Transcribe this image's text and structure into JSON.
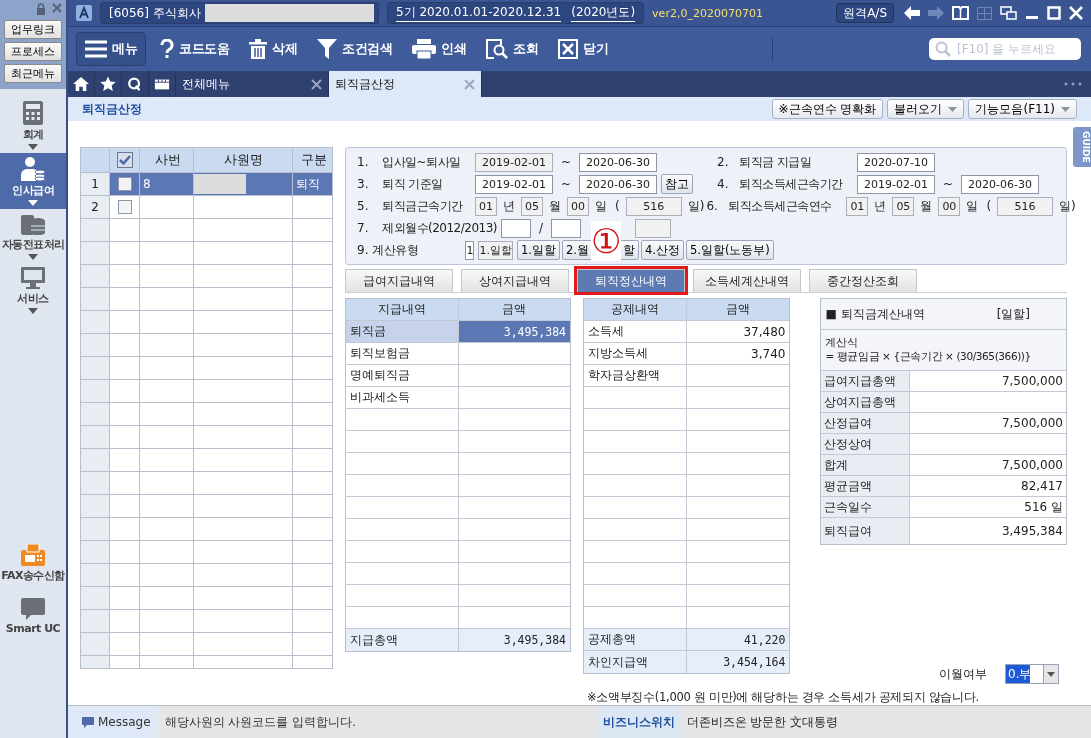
{
  "title_bar": {
    "company": "[6056] 주식회사",
    "period": "5기  2020.01.01-2020.12.31",
    "year": "(2020년도)",
    "version": "ver2,0_2020070701",
    "remote_button": "원격A/S"
  },
  "left_buttons": [
    "업무링크",
    "프로세스",
    "최근메뉴"
  ],
  "modules": [
    {
      "label": "회계",
      "kind": "calculator",
      "selected": false
    },
    {
      "label": "인사급여",
      "kind": "person",
      "selected": true
    },
    {
      "label": "자동전표처리",
      "kind": "database",
      "selected": false
    },
    {
      "label": "서비스",
      "kind": "monitor",
      "selected": false
    }
  ],
  "extra_modules": [
    {
      "label": "FAX송수신함",
      "kind": "fax"
    },
    {
      "label": "Smart UC",
      "kind": "uc"
    }
  ],
  "toolbar": [
    {
      "label": "메뉴",
      "kind": "menu"
    },
    {
      "label": "코드도움",
      "kind": "help"
    },
    {
      "label": "삭제",
      "kind": "trash"
    },
    {
      "label": "조건검색",
      "kind": "filter"
    },
    {
      "label": "인쇄",
      "kind": "print"
    },
    {
      "label": "조회",
      "kind": "view"
    },
    {
      "label": "닫기",
      "kind": "close"
    }
  ],
  "search": {
    "placeholder": "[F10] 을 누르세요"
  },
  "tabs": [
    {
      "label": "전체메뉴",
      "selected": false
    },
    {
      "label": "퇴직금산정",
      "selected": true
    }
  ],
  "page_title": "퇴직금산정",
  "page_buttons": [
    {
      "label": "※근속연수 명확화",
      "dropdown": false
    },
    {
      "label": "불러오기",
      "dropdown": true
    },
    {
      "label": "기능모음(F11)",
      "dropdown": true
    }
  ],
  "guide_tab": "GUIDE",
  "employees": {
    "columns": [
      "사번",
      "사원명",
      "구분"
    ],
    "header_checked": true,
    "rows": [
      {
        "no": "1",
        "checked": false,
        "id": "8",
        "type": "퇴직",
        "name_hidden": true,
        "selected": true
      },
      {
        "no": "2",
        "checked": false,
        "name_hidden": false,
        "selected": false
      }
    ]
  },
  "form": [
    {
      "left": [
        {
          "kind": "num",
          "text": "1."
        },
        {
          "kind": "label",
          "text": "입사일~퇴사일"
        },
        {
          "kind": "date_ro",
          "text": "2019-02-01"
        },
        {
          "kind": "sep",
          "text": "~"
        },
        {
          "kind": "date",
          "text": "2020-06-30"
        }
      ],
      "right": [
        {
          "kind": "num",
          "text": "2."
        },
        {
          "kind": "label",
          "text": "퇴직금 지급일"
        },
        {
          "kind": "date",
          "text": "2020-07-10"
        }
      ]
    },
    {
      "left": [
        {
          "kind": "num",
          "text": "3."
        },
        {
          "kind": "label",
          "text": "퇴직 기준일"
        },
        {
          "kind": "date",
          "text": "2019-02-01"
        },
        {
          "kind": "sep",
          "text": "~"
        },
        {
          "kind": "date",
          "text": "2020-06-30"
        },
        {
          "kind": "button",
          "text": "참고"
        }
      ],
      "right": [
        {
          "kind": "num",
          "text": "4."
        },
        {
          "kind": "label",
          "text": "퇴직소득세근속기간"
        },
        {
          "kind": "date",
          "text": "2019-02-01"
        },
        {
          "kind": "sep",
          "text": "~"
        },
        {
          "kind": "date",
          "text": "2020-06-30"
        }
      ]
    },
    {
      "left": [
        {
          "kind": "num",
          "text": "5."
        },
        {
          "kind": "label",
          "text": "퇴직금근속기간"
        },
        {
          "kind": "small_ro",
          "text": "01"
        },
        {
          "kind": "unit",
          "text": "년"
        },
        {
          "kind": "small_ro",
          "text": "05"
        },
        {
          "kind": "unit",
          "text": "월"
        },
        {
          "kind": "small_ro",
          "text": "00"
        },
        {
          "kind": "unit",
          "text": "일"
        },
        {
          "kind": "unit",
          "text": "("
        },
        {
          "kind": "days_ro",
          "text": "516"
        },
        {
          "kind": "unit",
          "text": "일)"
        }
      ],
      "right": [
        {
          "kind": "num",
          "text": "6."
        },
        {
          "kind": "label",
          "text": "퇴직소득세근속연수"
        },
        {
          "kind": "small_ro",
          "text": "01"
        },
        {
          "kind": "unit",
          "text": "년"
        },
        {
          "kind": "small_ro",
          "text": "05"
        },
        {
          "kind": "unit",
          "text": "월"
        },
        {
          "kind": "small_ro",
          "text": "00"
        },
        {
          "kind": "unit",
          "text": "일"
        },
        {
          "kind": "unit",
          "text": "("
        },
        {
          "kind": "days_ro",
          "text": "516"
        },
        {
          "kind": "unit",
          "text": "일)"
        }
      ]
    },
    {
      "left": [
        {
          "kind": "num",
          "text": "7."
        },
        {
          "kind": "label",
          "text": "제외월수(2012/2013)"
        },
        {
          "kind": "blank"
        },
        {
          "kind": "sep",
          "text": "/"
        },
        {
          "kind": "blank"
        },
        {
          "kind": "blank_ro"
        }
      ]
    },
    {
      "left": [
        {
          "kind": "num",
          "text": "9."
        },
        {
          "kind": "label",
          "text": "계산유형"
        },
        {
          "kind": "code",
          "text": "1"
        },
        {
          "kind": "small_label",
          "text": "1.일할"
        },
        {
          "kind": "button",
          "text": "1.일할"
        },
        {
          "kind": "button",
          "text": "2.월"
        },
        {
          "kind": "mark",
          "text": "①"
        },
        {
          "kind": "button",
          "text": "할"
        },
        {
          "kind": "button",
          "text": "4.산정"
        },
        {
          "kind": "button",
          "text": "5.일할(노동부)"
        }
      ]
    }
  ],
  "sub_tabs": [
    {
      "label": "급여지급내역",
      "selected": false,
      "highlighted": false
    },
    {
      "label": "상여지급내역",
      "selected": false,
      "highlighted": false
    },
    {
      "label": "퇴직정산내역",
      "selected": true,
      "highlighted": true
    },
    {
      "label": "소득세계산내역",
      "selected": false,
      "highlighted": false
    },
    {
      "label": "중간정산조회",
      "selected": false,
      "highlighted": false
    }
  ],
  "payments": {
    "columns": [
      "지급내역",
      "금액"
    ],
    "rows": [
      {
        "label": "퇴직금",
        "amount": "3,495,384",
        "selected": true
      },
      {
        "label": "퇴직보험금",
        "selected": false
      },
      {
        "label": "명예퇴직금",
        "selected": false
      },
      {
        "label": "비과세소득",
        "selected": false
      }
    ],
    "totals": [
      {
        "label": "지급총액",
        "amount": "3,495,384"
      }
    ]
  },
  "deductions": {
    "columns": [
      "공제내역",
      "금액"
    ],
    "rows": [
      {
        "label": "소득세",
        "amount": "37,480",
        "selected": false
      },
      {
        "label": "지방소득세",
        "amount": "3,740",
        "selected": false
      },
      {
        "label": "학자금상환액",
        "selected": false
      }
    ],
    "totals": [
      {
        "label": "공제총액",
        "amount": "41,220"
      },
      {
        "label": "차인지급액",
        "amount": "3,454,164"
      }
    ]
  },
  "calc": {
    "title": "■ 퇴직금계산내역",
    "type": "[일할]",
    "formula_label": "계산식",
    "formula": "= 평균임금 × {근속기간 × (30/365(366))}",
    "rows": [
      {
        "label": "급여지급총액",
        "value": "7,500,000"
      },
      {
        "label": "상여지급총액"
      },
      {
        "label": "산정급여",
        "value": "7,500,000"
      },
      {
        "label": "산정상여"
      },
      {
        "label": "합계",
        "value": "7,500,000"
      },
      {
        "label": "평균금액",
        "value": "82,417"
      },
      {
        "label": "근속일수",
        "value": "516 일"
      },
      {
        "label": "퇴직급여",
        "value": "3,495,384"
      }
    ]
  },
  "carry_over": {
    "label": "이월여부",
    "value": "0.부"
  },
  "note": "※소액부징수(1,000 원 미만)에 해당하는 경우 소득세가 공제되지 않습니다.",
  "status_bar": {
    "message_label": "Message",
    "message": "해당사원의 사원코드를 입력합니다.",
    "ticker_label": "비즈니스위치",
    "ticker": "더존비즈온  방문한 文대통령"
  }
}
